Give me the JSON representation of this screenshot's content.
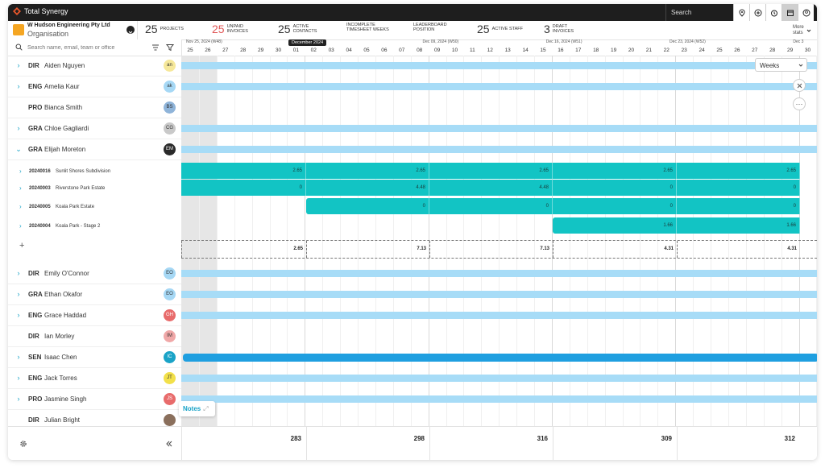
{
  "brand": "Total Synergy",
  "topbar": {
    "search_label": "Search",
    "icons": [
      "help-location-icon",
      "add-circle-icon",
      "alarm-icon",
      "calendar-icon",
      "user-icon"
    ]
  },
  "org": {
    "name": "W Hudson Engineering Pty Ltd",
    "type": "Organisation"
  },
  "stats": [
    {
      "num": "25",
      "label": "PROJECTS",
      "color": "#333333"
    },
    {
      "num": "25",
      "label": "UNPAID INVOICES",
      "color": "#e05757"
    },
    {
      "num": "25",
      "label": "ACTIVE CONTACTS",
      "color": "#333333"
    },
    {
      "num": "",
      "label": "INCOMPLETE TIMESHEET WEEKS",
      "color": "#333333"
    },
    {
      "num": "",
      "label": "LEADERBOARD POSITION",
      "color": "#333333"
    },
    {
      "num": "25",
      "label": "ACTIVE STAFF",
      "color": "#333333"
    },
    {
      "num": "3",
      "label": "DRAFT INVOICES",
      "color": "#333333"
    }
  ],
  "more_stats": "More stats",
  "search_placeholder": "Search name, email, team or office",
  "weeks": [
    "Nov 25, 2024 (W48)",
    "2024 (W49)",
    "Dec 09, 2024 (W50)",
    "Dec 16, 2024 (W51)",
    "Dec 23, 2024 (W52)",
    "Dec 3"
  ],
  "tooltip": "December 2024",
  "days": [
    "25",
    "26",
    "27",
    "28",
    "29",
    "30",
    "01",
    "02",
    "03",
    "04",
    "05",
    "06",
    "07",
    "08",
    "09",
    "10",
    "11",
    "12",
    "13",
    "14",
    "15",
    "16",
    "17",
    "18",
    "19",
    "20",
    "21",
    "22",
    "23",
    "24",
    "25",
    "26",
    "27",
    "28",
    "29",
    "30"
  ],
  "people": [
    {
      "role": "DIR",
      "name": "Aiden Nguyen",
      "initials": "an",
      "avatar_color": "#f6e89a",
      "expandable": true
    },
    {
      "role": "ENG",
      "name": "Amelia Kaur",
      "initials": "ak",
      "avatar_color": "#a6d8f5",
      "expandable": true
    },
    {
      "role": "PRO",
      "name": "Bianca Smith",
      "initials": "BS",
      "avatar_color": "#8fb4d9",
      "expandable": false
    },
    {
      "role": "GRA",
      "name": "Chloe Gagliardi",
      "initials": "CG",
      "avatar_color": "#c9c9c9",
      "expandable": true
    },
    {
      "role": "GRA",
      "name": "Elijah Moreton",
      "initials": "EM",
      "avatar_color": "#2a2a2a",
      "expandable": true,
      "expanded": true
    }
  ],
  "projects": [
    {
      "code": "20240016",
      "name": "Sunlit Shores Subdivision",
      "values": [
        "2.65",
        "2.65",
        "2.65",
        "2.65",
        "2.65"
      ]
    },
    {
      "code": "20240003",
      "name": "Riverstone Park Estate",
      "values": [
        "0",
        "4.48",
        "4.48",
        "0",
        "0"
      ]
    },
    {
      "code": "20240005",
      "name": "Koala Park Estate",
      "values": [
        "0",
        "0",
        "0",
        "0"
      ]
    },
    {
      "code": "20240004",
      "name": "Koala Park - Stage 2",
      "values": [
        "1.66",
        "1.66"
      ]
    }
  ],
  "summary": [
    "2.65",
    "7.13",
    "7.13",
    "4.31",
    "4.31"
  ],
  "people2": [
    {
      "role": "DIR",
      "name": "Emily O'Connor",
      "initials": "EO",
      "avatar_color": "#a6d8f5",
      "expandable": true
    },
    {
      "role": "GRA",
      "name": "Ethan Okafor",
      "initials": "EO",
      "avatar_color": "#a6d8f5",
      "expandable": true
    },
    {
      "role": "ENG",
      "name": "Grace Haddad",
      "initials": "GH",
      "avatar_color": "#e86b6b",
      "expandable": true
    },
    {
      "role": "DIR",
      "name": "Ian Morley",
      "initials": "IM",
      "avatar_color": "#f0a8a8",
      "expandable": false
    },
    {
      "role": "SEN",
      "name": "Isaac Chen",
      "initials": "IC",
      "avatar_color": "#1aa3c7",
      "expandable": true
    },
    {
      "role": "ENG",
      "name": "Jack Torres",
      "initials": "JT",
      "avatar_color": "#f2e04a",
      "expandable": true
    },
    {
      "role": "PRO",
      "name": "Jasmine Singh",
      "initials": "JS",
      "avatar_color": "#e86b6b",
      "expandable": true
    },
    {
      "role": "DIR",
      "name": "Julian Bright",
      "initials": "",
      "avatar_color": "#8a6f5c",
      "expandable": false
    }
  ],
  "footer_totals": [
    "283",
    "298",
    "316",
    "309",
    "312"
  ],
  "view_select": "Weeks",
  "notes_label": "Notes"
}
